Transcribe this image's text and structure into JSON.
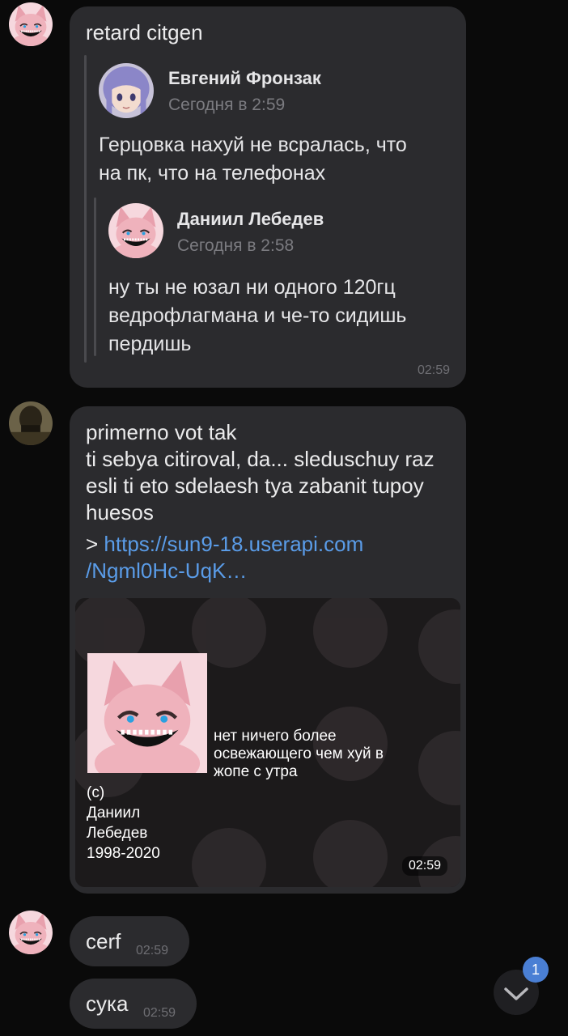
{
  "messages": [
    {
      "text": "retard citgen",
      "time": "02:59",
      "quote": {
        "name": "Евгений Фронзак",
        "date": "Сегодня в 2:59",
        "text": "Герцовка нахуй не всралась, что\nна пк, что на телефонах",
        "nested": {
          "name": "Даниил Лебедев",
          "date": "Сегодня в 2:58",
          "text": "ну ты не юзал ни одного 120гц\nведрофлагмана и че-то сидишь\nпердишь"
        }
      }
    },
    {
      "text": "primerno vot tak\nti sebya citiroval, da... sleduschuy raz\nesli ti eto sdelaesh tya zabanit tupoy\nhuesos",
      "link_prefix": "> ",
      "link_line1": "https://sun9-18.userapi.com",
      "link_line2": "/Ngml0Hc-UqK…",
      "image": {
        "caption": "нет ничего более\nосвежающего чем хуй в\nжопе с утра",
        "signature": "(c)\nДаниил\nЛебедев\n1998-2020",
        "time": "02:59"
      }
    },
    {
      "text": "cerf",
      "time": "02:59"
    },
    {
      "text": "сука",
      "time": "02:59"
    }
  ],
  "scroll_button": {
    "badge": "1",
    "icon": "chevron-down-icon"
  },
  "colors": {
    "background": "#0a0a0a",
    "bubble": "#2b2b2e",
    "link": "#5a9ce8",
    "badge": "#4a7fd4"
  }
}
